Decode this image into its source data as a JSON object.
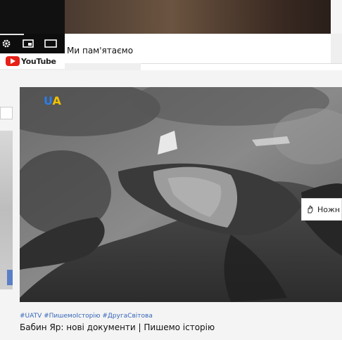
{
  "top_player": {
    "caption": "Ми пам'ятаємо",
    "settings_icon": "gear-icon",
    "miniplayer_icon": "miniplayer-icon",
    "theater_icon": "theater-mode-icon"
  },
  "youtube": {
    "wordmark": "YouTube"
  },
  "video": {
    "channel_logo": "UA",
    "tags": "#UATV #ПишемоІсторію #ДругаСвітова",
    "title": "Бабин Яр: нові документи | Пишемо історію"
  },
  "side_card": {
    "label": "Ножн",
    "icon": "hand-icon"
  },
  "colors": {
    "youtube_red": "#e62117",
    "tag_blue": "#3566b8",
    "logo_blue": "#2b7de9",
    "logo_yellow": "#f2c200"
  }
}
